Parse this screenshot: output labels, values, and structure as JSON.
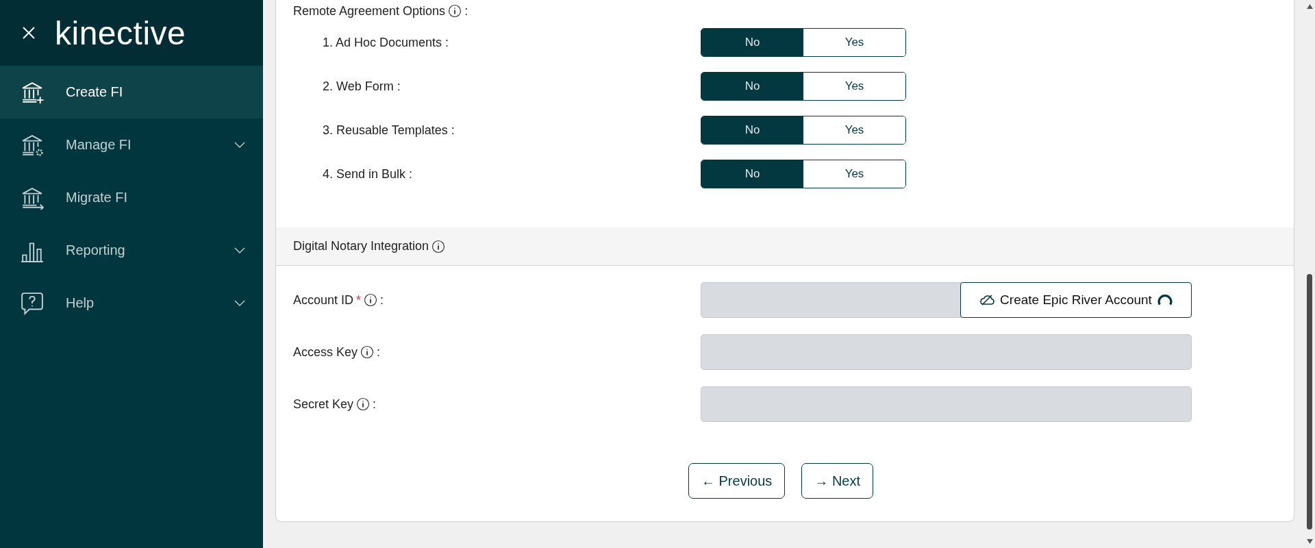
{
  "sidebar": {
    "brand": "kinective",
    "items": [
      {
        "label": "Create FI",
        "kind": "create",
        "selected": true,
        "expandable": false
      },
      {
        "label": "Manage FI",
        "kind": "manage",
        "selected": false,
        "expandable": true
      },
      {
        "label": "Migrate FI",
        "kind": "migrate",
        "selected": false,
        "expandable": false
      },
      {
        "label": "Reporting",
        "kind": "reporting",
        "selected": false,
        "expandable": true
      },
      {
        "label": "Help",
        "kind": "help",
        "selected": false,
        "expandable": true
      }
    ]
  },
  "remote_agreement": {
    "title": "Remote Agreement Options",
    "title_end": ":",
    "options": [
      {
        "label": "1. Ad Hoc Documents :",
        "choices": [
          {
            "label": "No",
            "selected": true
          },
          {
            "label": "Yes",
            "selected": false
          }
        ]
      },
      {
        "label": "2. Web Form :",
        "choices": [
          {
            "label": "No",
            "selected": true
          },
          {
            "label": "Yes",
            "selected": false
          }
        ]
      },
      {
        "label": "3. Reusable Templates :",
        "choices": [
          {
            "label": "No",
            "selected": true
          },
          {
            "label": "Yes",
            "selected": false
          }
        ]
      },
      {
        "label": "4. Send in Bulk :",
        "choices": [
          {
            "label": "No",
            "selected": true
          },
          {
            "label": "Yes",
            "selected": false
          }
        ]
      }
    ]
  },
  "digital_notary": {
    "title": "Digital Notary Integration",
    "fields": [
      {
        "label": "Account ID",
        "required_mark": "*",
        "label_end": ":",
        "action": {
          "label": "Create Epic River Account",
          "loading": true
        }
      },
      {
        "label": "Access Key",
        "label_end": ":"
      },
      {
        "label": "Secret Key",
        "label_end": ":"
      }
    ]
  },
  "nav_buttons": [
    {
      "label": "← Previous"
    },
    {
      "label": "→ Next"
    }
  ]
}
